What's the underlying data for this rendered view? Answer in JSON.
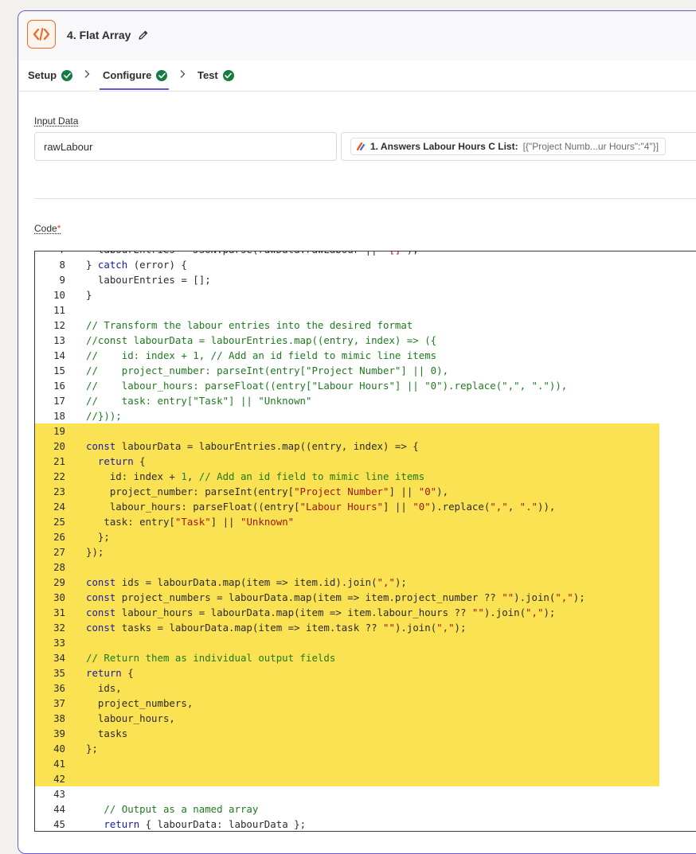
{
  "step": {
    "title": "4. Flat Array",
    "icon": "code-icon",
    "edit_icon": "pencil-icon"
  },
  "tabs": [
    {
      "label": "Setup",
      "status": "complete"
    },
    {
      "label": "Configure",
      "status": "complete",
      "active": true
    },
    {
      "label": "Test",
      "status": "complete"
    }
  ],
  "input_data": {
    "label": "Input Data",
    "key": "rawLabour",
    "source_icon": "zapier-source-icon",
    "source_label": "1. Answers Labour Hours C List:",
    "source_value": "[{\"Project Numb...ur Hours\":\"4\"}]"
  },
  "code": {
    "label": "Code",
    "required_marker": "*",
    "partial_top_line": "  labourEntries = JSON.parse(rawData.rawLabour || \"[]\");",
    "lines": [
      {
        "n": 8,
        "text": "} catch (error) {"
      },
      {
        "n": 9,
        "text": "  labourEntries = [];"
      },
      {
        "n": 10,
        "text": "}"
      },
      {
        "n": 11,
        "text": ""
      },
      {
        "n": 12,
        "text": "// Transform the labour entries into the desired format"
      },
      {
        "n": 13,
        "text": "//const labourData = labourEntries.map((entry, index) => ({"
      },
      {
        "n": 14,
        "text": "//    id: index + 1, // Add an id field to mimic line items"
      },
      {
        "n": 15,
        "text": "//    project_number: parseInt(entry[\"Project Number\"] || 0),"
      },
      {
        "n": 16,
        "text": "//    labour_hours: parseFloat((entry[\"Labour Hours\"] || \"0\").replace(\",\", \".\")),"
      },
      {
        "n": 17,
        "text": "//    task: entry[\"Task\"] || \"Unknown\""
      },
      {
        "n": 18,
        "text": "//}));"
      },
      {
        "n": 19,
        "text": ""
      },
      {
        "n": 20,
        "text": "const labourData = labourEntries.map((entry, index) => {"
      },
      {
        "n": 21,
        "text": "  return {"
      },
      {
        "n": 22,
        "text": "    id: index + 1, // Add an id field to mimic line items"
      },
      {
        "n": 23,
        "text": "    project_number: parseInt(entry[\"Project Number\"] || \"0\"),"
      },
      {
        "n": 24,
        "text": "    labour_hours: parseFloat((entry[\"Labour Hours\"] || \"0\").replace(\",\", \".\")),"
      },
      {
        "n": 25,
        "text": "   task: entry[\"Task\"] || \"Unknown\""
      },
      {
        "n": 26,
        "text": "  };"
      },
      {
        "n": 27,
        "text": "});"
      },
      {
        "n": 28,
        "text": ""
      },
      {
        "n": 29,
        "text": "const ids = labourData.map(item => item.id).join(\",\");"
      },
      {
        "n": 30,
        "text": "const project_numbers = labourData.map(item => item.project_number ?? \"\").join(\",\");"
      },
      {
        "n": 31,
        "text": "const labour_hours = labourData.map(item => item.labour_hours ?? \"\").join(\",\");"
      },
      {
        "n": 32,
        "text": "const tasks = labourData.map(item => item.task ?? \"\").join(\",\");"
      },
      {
        "n": 33,
        "text": ""
      },
      {
        "n": 34,
        "text": "// Return them as individual output fields"
      },
      {
        "n": 35,
        "text": "return {"
      },
      {
        "n": 36,
        "text": "  ids,"
      },
      {
        "n": 37,
        "text": "  project_numbers,"
      },
      {
        "n": 38,
        "text": "  labour_hours,"
      },
      {
        "n": 39,
        "text": "  tasks"
      },
      {
        "n": 40,
        "text": "};"
      },
      {
        "n": 41,
        "text": ""
      },
      {
        "n": 42,
        "text": ""
      },
      {
        "n": 43,
        "text": ""
      },
      {
        "n": 44,
        "text": "   // Output as a named array"
      },
      {
        "n": 45,
        "text": "   return { labourData: labourData };"
      }
    ],
    "highlighted_lines": [
      19,
      42
    ],
    "colors": {
      "comment": "#1f7a1f",
      "keyword": "#1a1aa6",
      "string": "#a31515",
      "number": "#098658",
      "highlight": "#fbe253"
    }
  },
  "colors": {
    "accent": "#6b57d4",
    "success": "#1a7a44",
    "app_icon": "#e86a23"
  }
}
